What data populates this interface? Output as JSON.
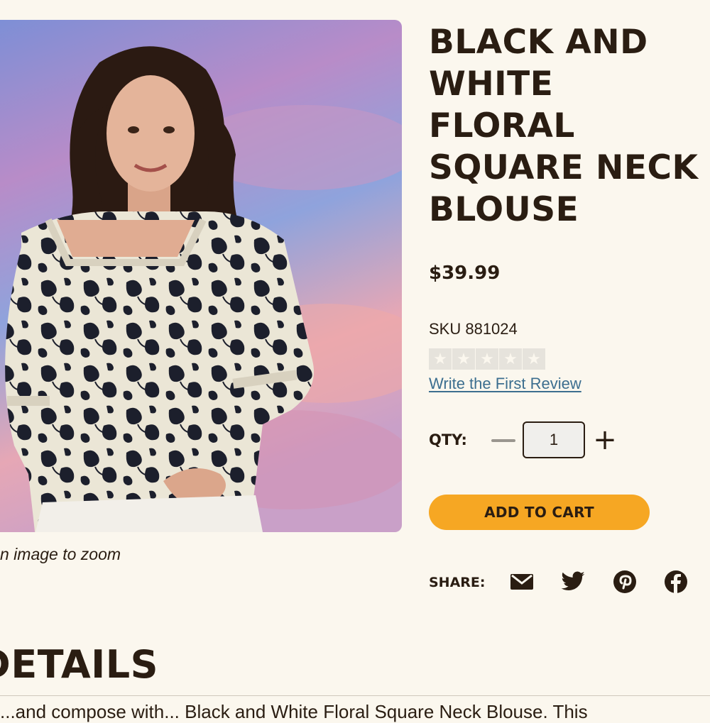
{
  "product": {
    "title_lines": [
      "BLACK AND",
      "WHITE",
      "FLORAL",
      "SQUARE NECK",
      "BLOUSE"
    ],
    "price": "$39.99",
    "sku": "SKU 881024",
    "rating_stars": 0,
    "rating_max": 5,
    "review_link": "Write the First Review"
  },
  "image": {
    "zoom_hint": "n image to zoom"
  },
  "qty": {
    "label": "QTY:",
    "value": "1"
  },
  "actions": {
    "add_to_cart": "ADD TO CART"
  },
  "share": {
    "label": "SHARE:",
    "icons": [
      "mail-icon",
      "twitter-icon",
      "pinterest-icon",
      "facebook-icon"
    ]
  },
  "details": {
    "heading": "DETAILS",
    "description_start": "...and compose with... Black and White Floral Square Neck Blouse. This"
  },
  "colors": {
    "background": "#fbf7ee",
    "text": "#2a1d12",
    "accent": "#f6a723",
    "link": "#3c6e8f"
  }
}
